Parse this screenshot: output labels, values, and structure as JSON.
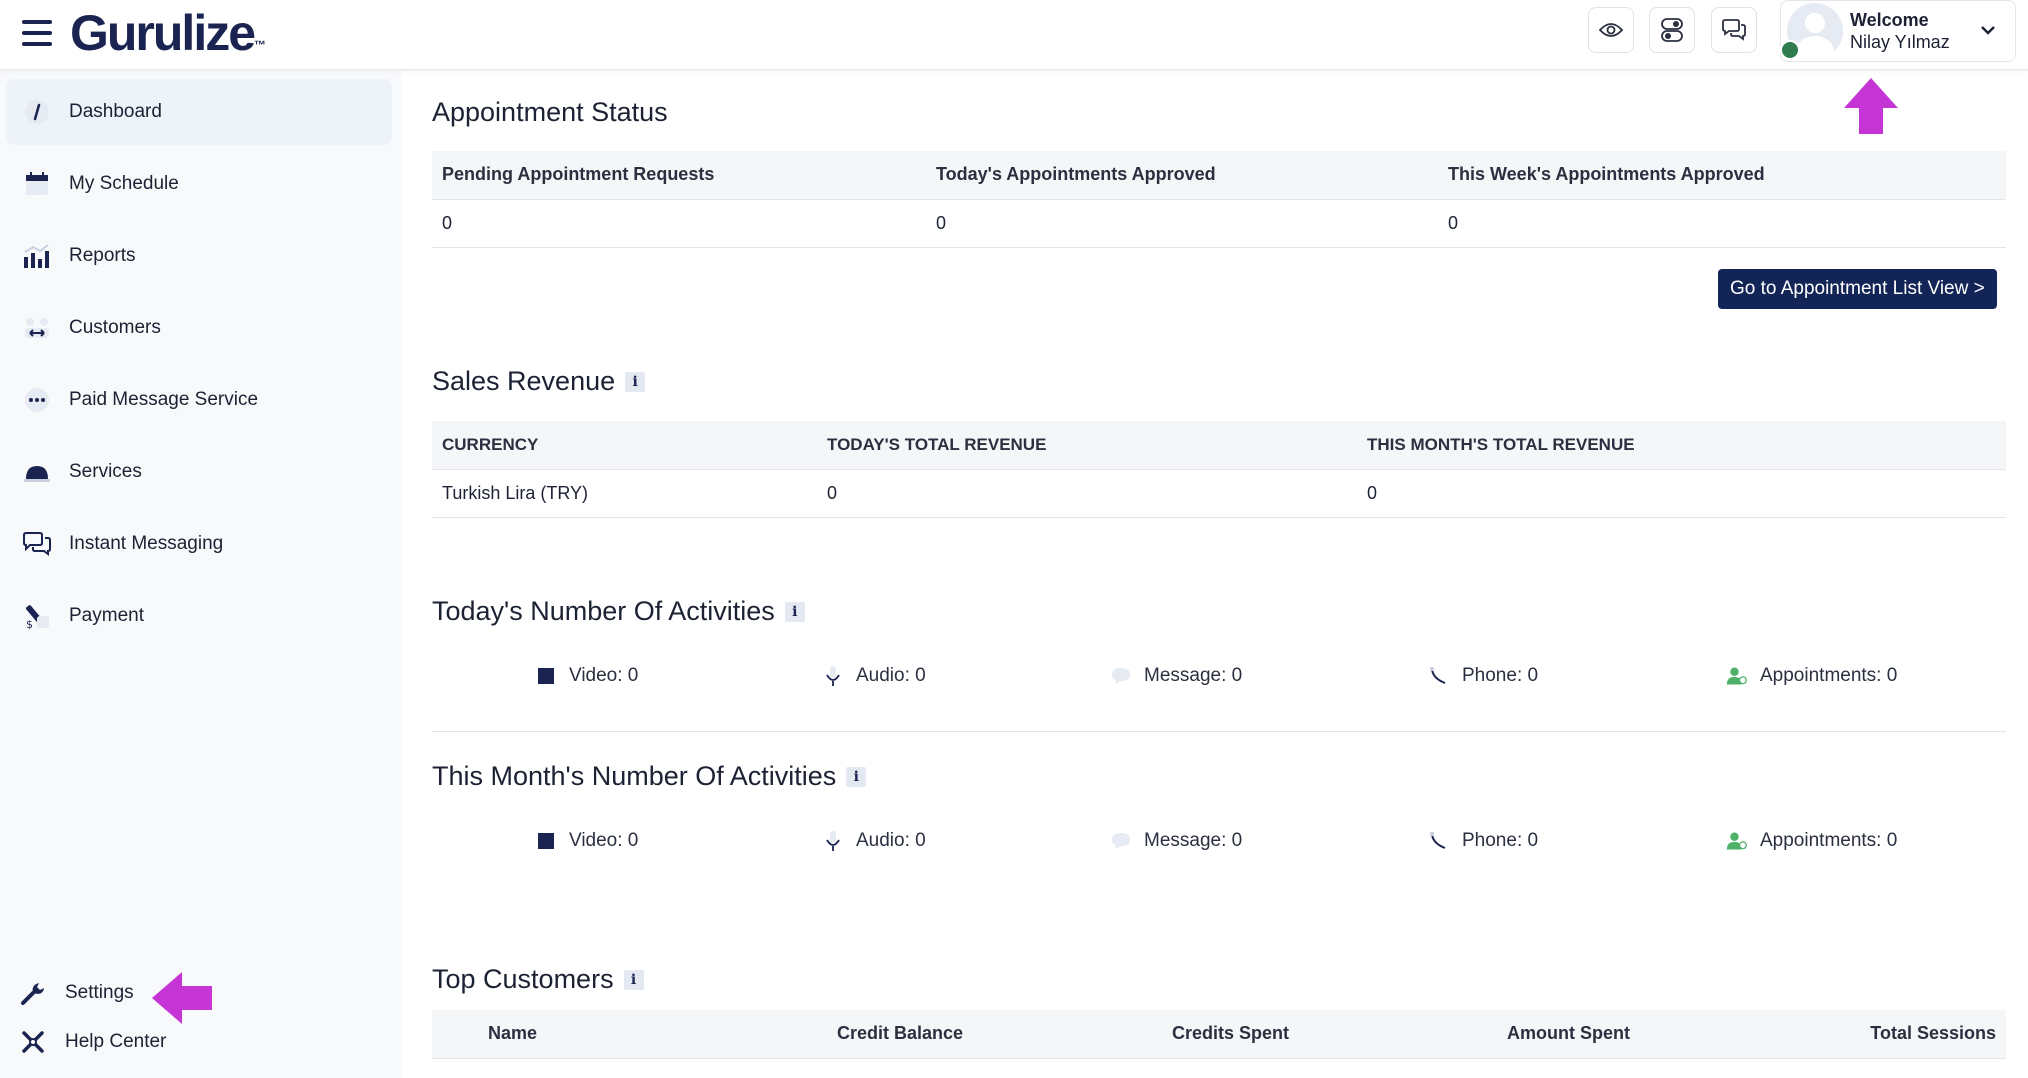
{
  "brand": {
    "name": "Gurulize",
    "trademark": "™"
  },
  "header": {
    "welcome": "Welcome",
    "username": "Nilay Yılmaz",
    "icons": [
      "eye-icon",
      "toggle-icon",
      "chat-icon"
    ]
  },
  "sidebar": {
    "items": [
      {
        "label": "Dashboard",
        "icon": "dashboard-icon",
        "active": true
      },
      {
        "label": "My Schedule",
        "icon": "calendar-icon"
      },
      {
        "label": "Reports",
        "icon": "bar-chart-icon"
      },
      {
        "label": "Customers",
        "icon": "customers-icon"
      },
      {
        "label": "Paid Message Service",
        "icon": "message-dots-icon"
      },
      {
        "label": "Services",
        "icon": "services-icon"
      },
      {
        "label": "Instant Messaging",
        "icon": "chat-bubbles-icon"
      },
      {
        "label": "Payment",
        "icon": "payment-icon"
      }
    ],
    "bottom": [
      {
        "label": "Settings",
        "icon": "wrench-icon"
      },
      {
        "label": "Help Center",
        "icon": "help-icon"
      }
    ]
  },
  "appointment_status": {
    "title": "Appointment Status",
    "columns": [
      "Pending Appointment Requests",
      "Today's Appointments Approved",
      "This Week's Appointments Approved"
    ],
    "values": [
      "0",
      "0",
      "0"
    ],
    "button": "Go to Appointment List View >"
  },
  "sales_revenue": {
    "title": "Sales Revenue",
    "columns": [
      "CURRENCY",
      "TODAY'S TOTAL REVENUE",
      "THIS MONTH'S TOTAL REVENUE"
    ],
    "rows": [
      [
        "Turkish Lira (TRY)",
        "0",
        "0"
      ]
    ]
  },
  "today_activities": {
    "title": "Today's Number Of Activities",
    "items": [
      "Video: 0",
      "Audio: 0",
      "Message: 0",
      "Phone: 0",
      "Appointments: 0"
    ]
  },
  "month_activities": {
    "title": "This Month's Number Of Activities",
    "items": [
      "Video: 0",
      "Audio: 0",
      "Message: 0",
      "Phone: 0",
      "Appointments: 0"
    ]
  },
  "top_customers": {
    "title": "Top Customers",
    "columns": [
      "Name",
      "Credit Balance",
      "Credits Spent",
      "Amount Spent",
      "Total Sessions"
    ]
  },
  "colors": {
    "primary": "#132457",
    "accent_arrow": "#c535d6",
    "online": "#2f7d4e",
    "active_nav": "#eef2f9"
  }
}
